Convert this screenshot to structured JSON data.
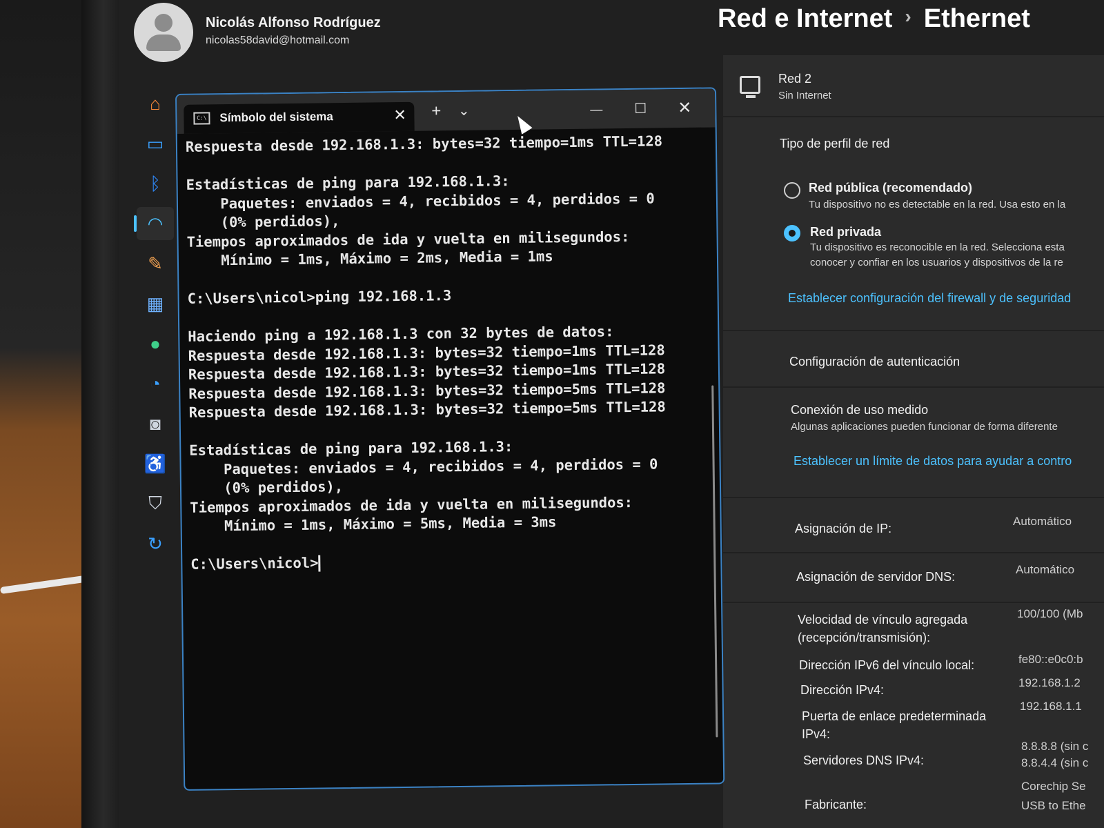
{
  "account": {
    "name": "Nicolás Alfonso Rodríguez",
    "email": "nicolas58david@hotmail.com"
  },
  "breadcrumb": {
    "parent": "Red e Internet",
    "separator": "›",
    "current": "Ethernet"
  },
  "nav_items": [
    {
      "name": "home-icon",
      "glyph": "⌂",
      "color": "#ff8c3a"
    },
    {
      "name": "system-icon",
      "glyph": "▭",
      "color": "#3aa0ff"
    },
    {
      "name": "bluetooth-icon",
      "glyph": "ᛒ",
      "color": "#2f8bff"
    },
    {
      "name": "network-icon",
      "glyph": "◠",
      "color": "#4cc2ff",
      "active": true
    },
    {
      "name": "personalization-icon",
      "glyph": "✎",
      "color": "#f0a050"
    },
    {
      "name": "apps-icon",
      "glyph": "▦",
      "color": "#6fb2ff"
    },
    {
      "name": "accounts-icon",
      "glyph": "●",
      "color": "#3fd08a"
    },
    {
      "name": "time-language-icon",
      "glyph": "◔",
      "color": "#3aa0ff"
    },
    {
      "name": "gaming-icon",
      "glyph": "◙",
      "color": "#cfd6e0"
    },
    {
      "name": "accessibility-icon",
      "glyph": "♿",
      "color": "#3aa0ff"
    },
    {
      "name": "privacy-security-icon",
      "glyph": "⛉",
      "color": "#cfd6e0"
    },
    {
      "name": "windows-update-icon",
      "glyph": "↻",
      "color": "#3aa0ff"
    }
  ],
  "terminal": {
    "tab_title": "Símbolo del sistema",
    "tab_close": "✕",
    "new_tab": "+",
    "dropdown": "⌄",
    "minimize": "—",
    "maximize": "☐",
    "close": "✕",
    "icon_text": "C:\\",
    "lines": [
      "Respuesta desde 192.168.1.3: bytes=32 tiempo=1ms TTL=128",
      "",
      "Estadísticas de ping para 192.168.1.3:",
      "    Paquetes: enviados = 4, recibidos = 4, perdidos = 0",
      "    (0% perdidos),",
      "Tiempos aproximados de ida y vuelta en milisegundos:",
      "    Mínimo = 1ms, Máximo = 2ms, Media = 1ms",
      "",
      "C:\\Users\\nicol>ping 192.168.1.3",
      "",
      "Haciendo ping a 192.168.1.3 con 32 bytes de datos:",
      "Respuesta desde 192.168.1.3: bytes=32 tiempo=1ms TTL=128",
      "Respuesta desde 192.168.1.3: bytes=32 tiempo=1ms TTL=128",
      "Respuesta desde 192.168.1.3: bytes=32 tiempo=5ms TTL=128",
      "Respuesta desde 192.168.1.3: bytes=32 tiempo=5ms TTL=128",
      "",
      "Estadísticas de ping para 192.168.1.3:",
      "    Paquetes: enviados = 4, recibidos = 4, perdidos = 0",
      "    (0% perdidos),",
      "Tiempos aproximados de ida y vuelta en milisegundos:",
      "    Mínimo = 1ms, Máximo = 5ms, Media = 3ms",
      ""
    ],
    "prompt": "C:\\Users\\nicol>"
  },
  "settings": {
    "network_name": "Red 2",
    "network_status": "Sin Internet",
    "profile_heading": "Tipo de perfil de red",
    "public_label": "Red pública (recomendado)",
    "public_desc": "Tu dispositivo no es detectable en la red. Usa esto en la",
    "private_label": "Red privada",
    "private_desc_1": "Tu dispositivo es reconocible en la red. Selecciona esta",
    "private_desc_2": "conocer y confiar en los usuarios y dispositivos de la re",
    "firewall_link": "Establecer configuración del firewall y de seguridad",
    "auth_settings": "Configuración de autenticación",
    "metered_title": "Conexión de uso medido",
    "metered_desc": "Algunas aplicaciones pueden funcionar de forma diferente",
    "data_limit_link": "Establecer un límite de datos para ayudar a contro",
    "ip_assignment_label": "Asignación de IP:",
    "ip_assignment_value": "Automático",
    "dns_assignment_label": "Asignación de servidor DNS:",
    "dns_assignment_value": "Automático",
    "link_speed_label_1": "Velocidad de vínculo agregada",
    "link_speed_label_2": "(recepción/transmisión):",
    "link_speed_value": "100/100 (Mb",
    "ipv6_label": "Dirección IPv6 del vínculo local:",
    "ipv6_value": "fe80::e0c0:b",
    "ipv4_label": "Dirección IPv4:",
    "ipv4_value": "192.168.1.2",
    "gateway_label_1": "Puerta de enlace predeterminada",
    "gateway_label_2": "IPv4:",
    "gateway_value": "192.168.1.1",
    "dns_servers_label": "Servidores DNS IPv4:",
    "dns_server_1": "8.8.8.8 (sin c",
    "dns_server_2": "8.8.4.4 (sin c",
    "manufacturer_label": "Fabricante:",
    "manufacturer_value": "Corechip Se",
    "manufacturer_value_2": "USB to Ethe"
  }
}
